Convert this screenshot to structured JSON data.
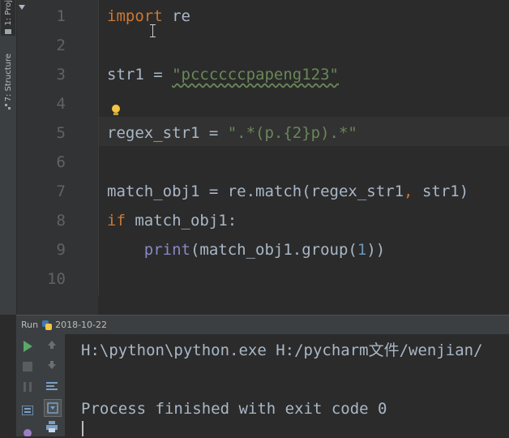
{
  "sidebar": {
    "tabs": [
      {
        "label": "1: Proj",
        "icon": "project-icon"
      },
      {
        "label": "7: Structure",
        "icon": "structure-icon"
      }
    ]
  },
  "editor": {
    "line_numbers": [
      "1",
      "2",
      "3",
      "4",
      "5",
      "6",
      "7",
      "8",
      "9",
      "10"
    ],
    "lines": {
      "l1": {
        "kw": "import",
        "rest": " re"
      },
      "l3": {
        "name": "str1 = ",
        "str": "\"pccccccpapeng123\""
      },
      "l5": {
        "name": "regex_str1 = ",
        "str": "\".*(p.{2}p).*\""
      },
      "l7": {
        "a": "match_obj1 = re.match(regex_str1",
        "comma": ",",
        "b": " str1)"
      },
      "l8": {
        "kw": "if",
        "rest": " match_obj1:"
      },
      "l9": {
        "indent": "    ",
        "builtin": "print",
        "a": "(match_obj1.group(",
        "num": "1",
        "b": "))"
      }
    },
    "intention_icon": "lightbulb-icon"
  },
  "run_panel": {
    "label": "Run",
    "config_name": "2018-10-22",
    "console_lines": [
      "H:\\python\\python.exe H:/pycharm文件/wenjian/",
      "",
      "Process finished with exit code 0"
    ],
    "toolbar_icons": [
      "run-icon",
      "up-arrow-icon",
      "stop-icon",
      "down-arrow-icon",
      "pause-icon",
      "soft-wrap-icon",
      "layout-icon",
      "scroll-to-end-icon",
      "debug-icon",
      "print-icon"
    ]
  },
  "colors": {
    "background": "#2b2b2b",
    "keyword": "#cc7832",
    "string": "#6a8759",
    "builtin": "#8888c6",
    "number": "#6897bb",
    "text": "#a9b7c6",
    "run_green": "#59a869"
  }
}
